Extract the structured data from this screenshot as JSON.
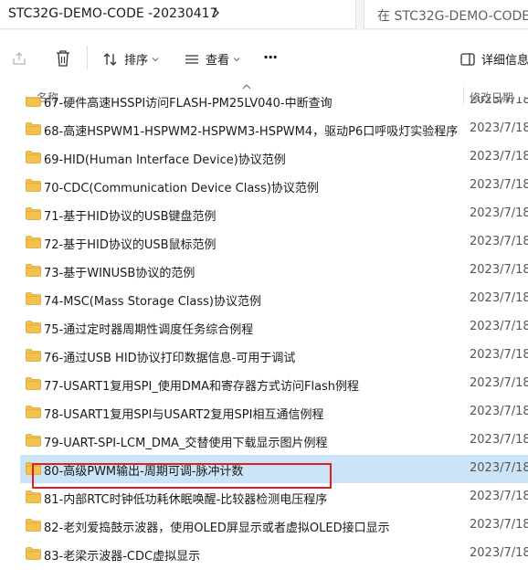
{
  "address_bar": {
    "path": "STC32G-DEMO-CODE -20230417",
    "search_placeholder": "在 STC32G-DEMO-CODE -2"
  },
  "toolbar": {
    "sort_label": "排序",
    "view_label": "查看",
    "more_label": "···",
    "details_label": "详细信息"
  },
  "columns": {
    "name": "名称",
    "date": "修改日期"
  },
  "rows": [
    {
      "name": "67-硬件高速HSSPI访问FLASH-PM25LV040-中断查询",
      "date": "2023/7/18"
    },
    {
      "name": "68-高速HSPWM1-HSPWM2-HSPWM3-HSPWM4，驱动P6口呼吸灯实验程序",
      "date": "2023/7/18"
    },
    {
      "name": "69-HID(Human Interface Device)协议范例",
      "date": "2023/7/18"
    },
    {
      "name": "70-CDC(Communication Device Class)协议范例",
      "date": "2023/7/18"
    },
    {
      "name": "71-基于HID协议的USB键盘范例",
      "date": "2023/7/18"
    },
    {
      "name": "72-基于HID协议的USB鼠标范例",
      "date": "2023/7/18"
    },
    {
      "name": "73-基于WINUSB协议的范例",
      "date": "2023/7/18"
    },
    {
      "name": "74-MSC(Mass Storage Class)协议范例",
      "date": "2023/7/18"
    },
    {
      "name": "75-通过定时器周期性调度任务综合例程",
      "date": "2023/7/18"
    },
    {
      "name": "76-通过USB HID协议打印数据信息-可用于调试",
      "date": "2023/7/18"
    },
    {
      "name": "77-USART1复用SPI_使用DMA和寄存器方式访问Flash例程",
      "date": "2023/7/18"
    },
    {
      "name": "78-USART1复用SPI与USART2复用SPI相互通信例程",
      "date": "2023/7/18"
    },
    {
      "name": "79-UART-SPI-LCM_DMA_交替使用下载显示图片例程",
      "date": "2023/7/18"
    },
    {
      "name": "80-高级PWM输出-周期可调-脉冲计数",
      "date": "2023/7/18"
    },
    {
      "name": "81-内部RTC时钟低功耗休眠唤醒-比较器检测电压程序",
      "date": "2023/7/18"
    },
    {
      "name": "82-老刘爱捣鼓示波器，使用OLED屏显示或者虚拟OLED接口显示",
      "date": "2023/7/18"
    },
    {
      "name": "83-老梁示波器-CDC虚拟显示",
      "date": "2023/7/18"
    }
  ],
  "colors": {
    "selection": "#cce4f7",
    "highlight_border": "#e02020",
    "folder": "#f2c14e"
  }
}
